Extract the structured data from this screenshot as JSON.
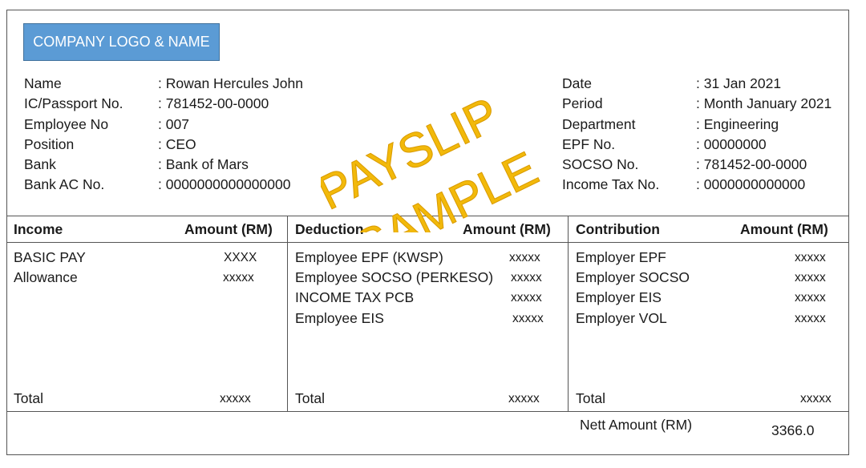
{
  "company": {
    "logo_text": "COMPANY LOGO & NAME"
  },
  "watermark": {
    "line1": "PAYSLIP",
    "line2": "SAMPLE",
    "color": "#f2b90a"
  },
  "employee": [
    {
      "label": "Name",
      "value": ": Rowan Hercules John"
    },
    {
      "label": "IC/Passport No.",
      "value": ": 781452-00-0000"
    },
    {
      "label": "Employee No",
      "value": ": 007"
    },
    {
      "label": "Position",
      "value": ": CEO"
    },
    {
      "label": "Bank",
      "value": ": Bank of Mars"
    },
    {
      "label": "Bank AC No.",
      "value": ": 0000000000000000"
    }
  ],
  "payslip": [
    {
      "label": "Date",
      "value": ": 31 Jan 2021"
    },
    {
      "label": "Period",
      "value": ": Month January 2021"
    },
    {
      "label": "Department",
      "value": ": Engineering"
    },
    {
      "label": "EPF No.",
      "value": ": 00000000"
    },
    {
      "label": "SOCSO No.",
      "value": ": 781452-00-0000"
    },
    {
      "label": "Income Tax No.",
      "value": ": 0000000000000"
    }
  ],
  "income": {
    "header": "Income",
    "amount_header": "Amount (RM)",
    "items": [
      {
        "label": "BASIC PAY",
        "amount": "XXXX"
      },
      {
        "label": "Allowance",
        "amount": "xxxxx"
      }
    ],
    "total_label": "Total",
    "total_amount": "xxxxx"
  },
  "deduction": {
    "header": "Deduction",
    "amount_header": "Amount (RM)",
    "items": [
      {
        "label": "Employee EPF (KWSP)",
        "amount": "xxxxx"
      },
      {
        "label": "Employee SOCSO (PERKESO)",
        "amount": "xxxxx"
      },
      {
        "label": "INCOME TAX PCB",
        "amount": "xxxxx"
      },
      {
        "label": "Employee EIS",
        "amount": "xxxxx"
      }
    ],
    "total_label": "Total",
    "total_amount": "xxxxx"
  },
  "contribution": {
    "header": "Contribution",
    "amount_header": "Amount (RM)",
    "items": [
      {
        "label": "Employer EPF",
        "amount": "xxxxx"
      },
      {
        "label": "Employer SOCSO",
        "amount": "xxxxx"
      },
      {
        "label": "Employer EIS",
        "amount": "xxxxx"
      },
      {
        "label": "Employer VOL",
        "amount": "xxxxx"
      }
    ],
    "total_label": "Total",
    "total_amount": "xxxxx"
  },
  "nett": {
    "label": "Nett Amount (RM)",
    "value": "3366.0"
  }
}
